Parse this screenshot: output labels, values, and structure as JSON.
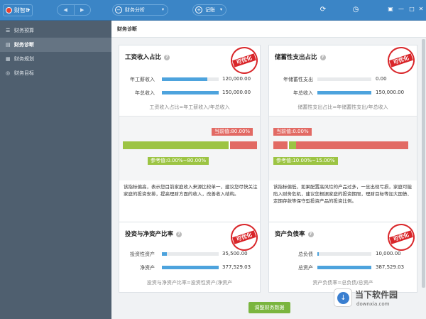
{
  "topbar": {
    "app_name": "财智8",
    "prev_arrow": "◀",
    "next_arrow": "▶",
    "module_label": "财务分析",
    "record_label": "记账",
    "dropdown_glyph": "▾"
  },
  "sidebar": {
    "items": [
      {
        "label": "财务预算",
        "icon": "list-icon"
      },
      {
        "label": "财务诊断",
        "icon": "document-icon"
      },
      {
        "label": "财务规划",
        "icon": "calendar-icon"
      },
      {
        "label": "财务目标",
        "icon": "target-icon"
      }
    ]
  },
  "main": {
    "title": "财务诊断",
    "stamp_text": "可优化",
    "cards": [
      {
        "title": "工资收入占比",
        "rows": [
          {
            "label": "年工薪收入",
            "value": "120,000.00",
            "fill": 0.8
          },
          {
            "label": "年总收入",
            "value": "150,000.00",
            "fill": 1.0
          }
        ],
        "formula": "工资收入占比=年工薪收入/年总收入",
        "current_tag": "当前值:80.00%",
        "reference_tag": "参考值:0.00%~80.00%",
        "current_value": 80.0,
        "reference_range": [
          0.0,
          80.0
        ],
        "description": "该指标偏高，表示您目前家庭收入来源比较单一，建议您尽快关注家庭的投资安排，提高理财方面的收入，改善收入结构。"
      },
      {
        "title": "储蓄性支出占比",
        "rows": [
          {
            "label": "年储蓄性支出",
            "value": "0.00",
            "fill": 0.0
          },
          {
            "label": "年总收入",
            "value": "150,000.00",
            "fill": 1.0
          }
        ],
        "formula": "储蓄性支出占比=年储蓄性支出/年总收入",
        "current_tag": "当前值:0.00%",
        "reference_tag": "参考值:10.00%~15.00%",
        "current_value": 0.0,
        "reference_range": [
          10.0,
          15.0
        ],
        "description": "该指标偏低，如果配置高风险的产品过多，一旦出现亏损，家庭可能陷入财务危机，建议您根据家庭的投资期限，理财目标等加大国债、定期存款等保守型投资产品的投资比例。"
      },
      {
        "title": "投资与净资产比率",
        "rows": [
          {
            "label": "投资性资产",
            "value": "35,500.00",
            "fill": 0.09
          },
          {
            "label": "净资产",
            "value": "377,529.03",
            "fill": 1.0
          }
        ],
        "formula": "投资与净资产比率=投资性资产/净资产"
      },
      {
        "title": "资产负债率",
        "rows": [
          {
            "label": "总负债",
            "value": "10,000.00",
            "fill": 0.026
          },
          {
            "label": "总资产",
            "value": "387,529.03",
            "fill": 1.0
          }
        ],
        "formula": "资产负债率=总负债/总资产"
      }
    ],
    "adjust_button": "调整财务数据"
  },
  "watermark": {
    "title": "当下软件园",
    "url": "downxia.com"
  },
  "colors": {
    "topbar": "#3b85c6",
    "sidebar": "#4f5f6f",
    "accent_blue": "#4da3dd",
    "red": "#e26a64",
    "green": "#9cc443",
    "stamp_red": "#d9262a"
  }
}
